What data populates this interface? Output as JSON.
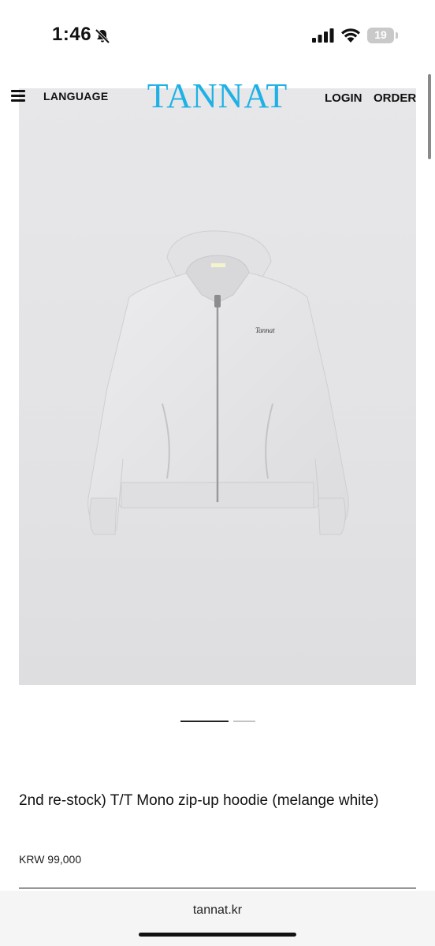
{
  "status_bar": {
    "time": "1:46",
    "battery": "19",
    "icons": [
      "bell-slash-icon",
      "cellular-signal-icon",
      "wifi-icon",
      "battery-icon"
    ]
  },
  "header": {
    "menu_icon": "hamburger-menu-icon",
    "language_label": "LANGUAGE",
    "logo": "TANNAT",
    "login_label": "LOGIN",
    "order_label": "ORDER"
  },
  "colors": {
    "logo": "#1fb1e6",
    "image_background": "#e5e5e7",
    "hoodie": "#e9e9eb"
  },
  "product": {
    "image_subject": "hoodie-image",
    "chest_logo": "Tannat",
    "label_text": "TANNAT",
    "title": "2nd re-stock) T/T Mono zip-up hoodie (melange white)",
    "price": "KRW 99,000"
  },
  "carousel": {
    "current_slide": 1,
    "total_slides": 2
  },
  "browser": {
    "url": "tannat.kr"
  }
}
